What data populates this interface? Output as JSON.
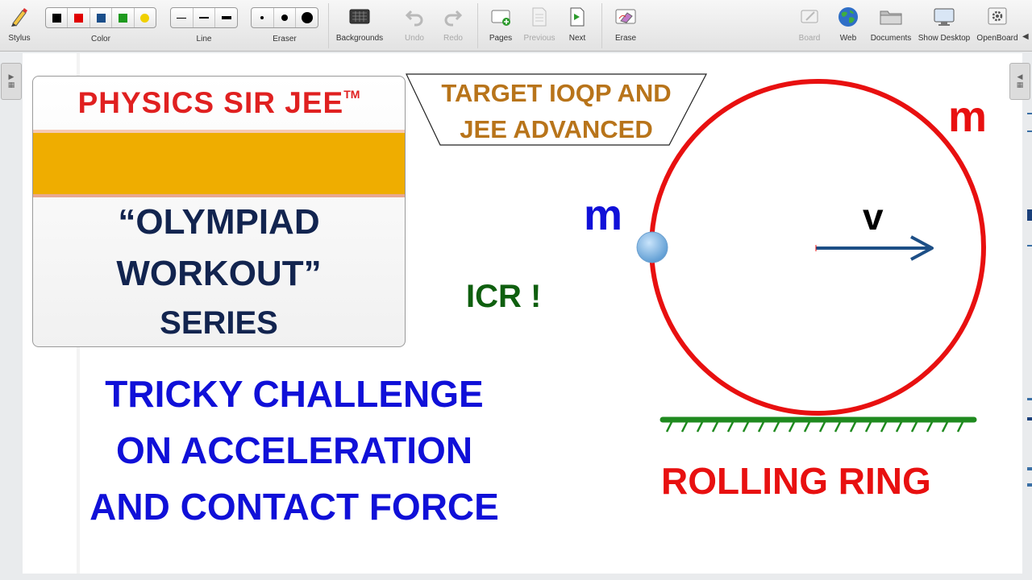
{
  "toolbar": {
    "stylus": "Stylus",
    "color": "Color",
    "colors": [
      "#000000",
      "#e00000",
      "#1a4e8a",
      "#1e9a1e",
      "#f0d000"
    ],
    "line": "Line",
    "eraser": "Eraser",
    "backgrounds": "Backgrounds",
    "undo": "Undo",
    "redo": "Redo",
    "pages": "Pages",
    "previous": "Previous",
    "next": "Next",
    "erase": "Erase",
    "board": "Board",
    "web": "Web",
    "documents": "Documents",
    "show_desktop": "Show Desktop",
    "openboard": "OpenBoard"
  },
  "slide": {
    "brand": "PHYSICS SIR JEE",
    "trademark": "TM",
    "series_line1": "“OLYMPIAD",
    "series_line2": "WORKOUT”",
    "series_line3": "SERIES",
    "target_line1": "TARGET IOQP AND",
    "target_line2": "JEE ADVANCED",
    "challenge_line1": "TRICKY CHALLENGE",
    "challenge_line2": "ON ACCELERATION",
    "challenge_line3": "AND CONTACT FORCE",
    "icr": "ICR !",
    "mass_ring": "m",
    "mass_bead": "m",
    "velocity": "v",
    "caption": "ROLLING RING"
  },
  "colors": {
    "brand": "#e02020",
    "band": "#efad00",
    "series": "#12244f",
    "target": "#b8741a",
    "challenge": "#1010d8",
    "icr": "#0f5f0f",
    "ring": "#e81010",
    "bead": "#7fb6e0",
    "arrow": "#1d4f86",
    "ground": "#1f8a1f",
    "caption": "#e81010",
    "mass_bead_label": "#1010d8",
    "mass_ring_label": "#e81010"
  }
}
